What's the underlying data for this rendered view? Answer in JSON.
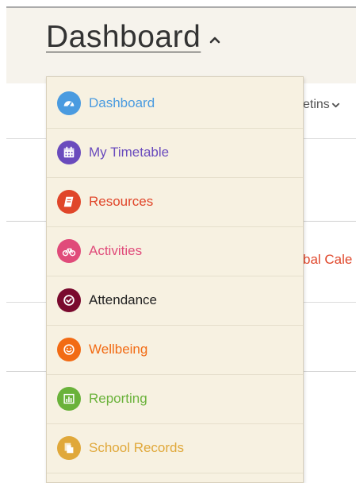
{
  "header": {
    "title": "Dashboard"
  },
  "background": {
    "bulletins_fragment": "etins",
    "calendar_fragment": "bal Cale"
  },
  "menu": {
    "items": [
      {
        "label": "Dashboard",
        "color": "#4a9be0",
        "icon": "dashboard-gauge-icon"
      },
      {
        "label": "My Timetable",
        "color": "#6a4bbd",
        "icon": "calendar-icon"
      },
      {
        "label": "Resources",
        "color": "#e0462a",
        "icon": "book-icon"
      },
      {
        "label": "Activities",
        "color": "#e04b7a",
        "icon": "bicycle-icon"
      },
      {
        "label": "Attendance",
        "color": "#7a0a2e",
        "icon": "check-circle-icon"
      },
      {
        "label": "Wellbeing",
        "color": "#f26b14",
        "icon": "smiley-icon"
      },
      {
        "label": "Reporting",
        "color": "#6ab23a",
        "icon": "bar-chart-icon"
      },
      {
        "label": "School Records",
        "color": "#e0a83a",
        "icon": "documents-icon"
      }
    ]
  }
}
